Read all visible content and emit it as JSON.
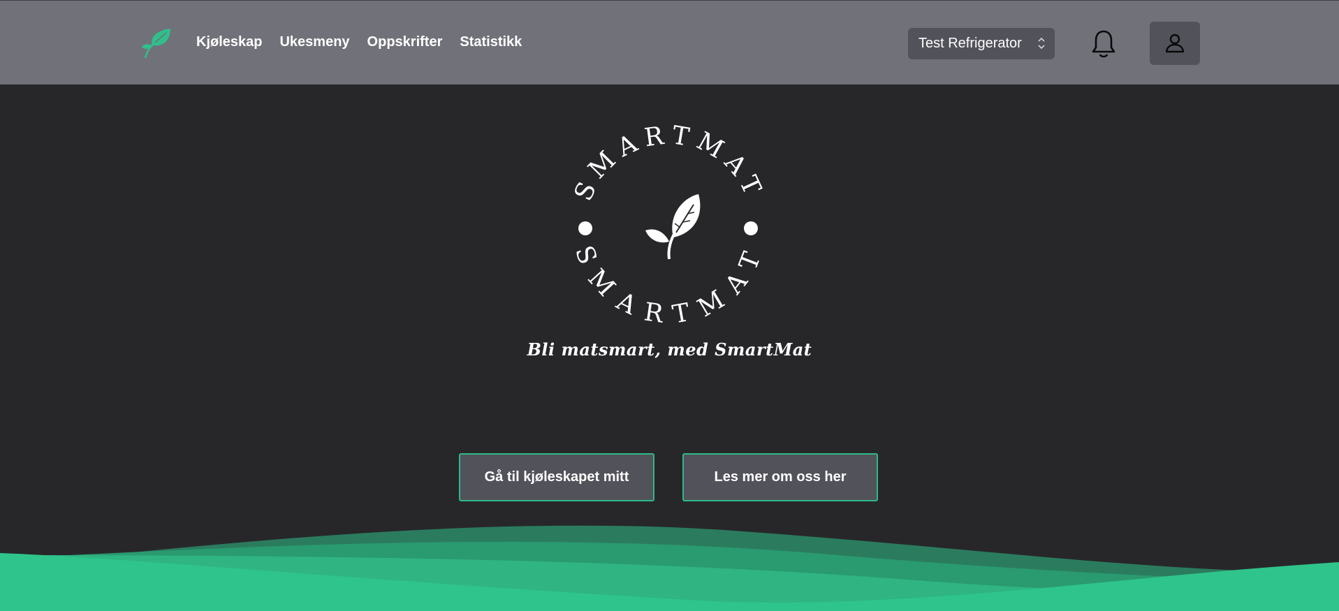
{
  "nav": {
    "logo_icon": "leaf-icon",
    "links": [
      "Kjøleskap",
      "Ukesmeny",
      "Oppskrifter",
      "Statistikk"
    ],
    "fridge_selector": "Test Refrigerator",
    "notification_icon": "bell-icon",
    "profile_icon": "user-icon"
  },
  "hero": {
    "emblem_text": "SMARTMAT",
    "slogan": "Bli matsmart, med SmartMat",
    "buttons": {
      "primary": "Gå til kjøleskapet mitt",
      "secondary": "Les mer om oss her"
    }
  },
  "colors": {
    "navbar": "#71717a",
    "background": "#27272a",
    "accent": "#2dba86",
    "button": "#52525b"
  }
}
